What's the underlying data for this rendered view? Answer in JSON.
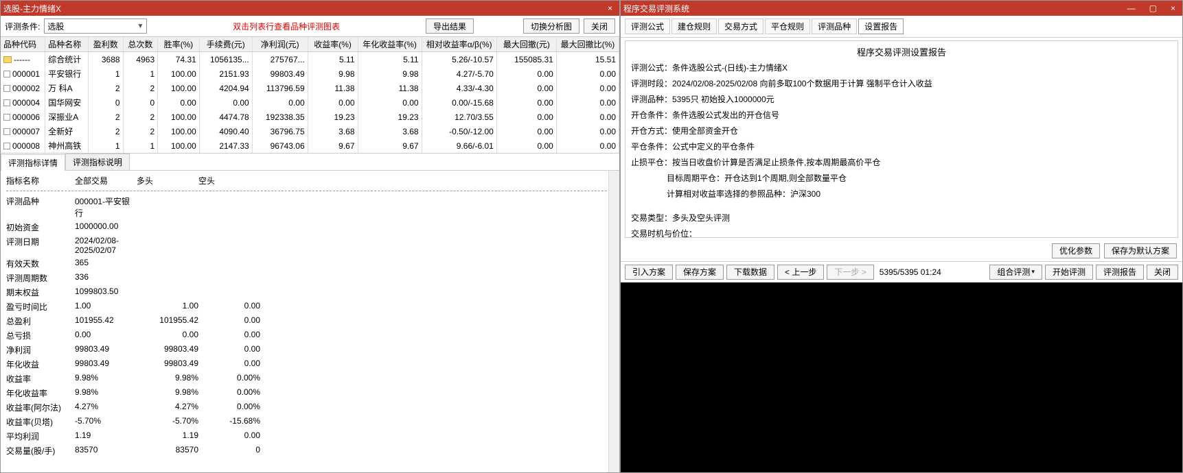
{
  "left": {
    "title": "选股-主力情绪X",
    "cond_label": "评测条件:",
    "cond_value": "选股",
    "hint": "双击列表行查看品种评测图表",
    "btn_export": "导出结果",
    "btn_switch": "切换分析图",
    "btn_close": "关闭",
    "columns": [
      "品种代码",
      "品种名称",
      "盈利数",
      "总次数",
      "胜率(%)",
      "手续费(元)",
      "净利润(元)",
      "收益率(%)",
      "年化收益率(%)",
      "相对收益率α/β(%)",
      "最大回撤(元)",
      "最大回撤比(%)"
    ],
    "rows": [
      {
        "icon": "folder",
        "code": "------",
        "name": "综合统计",
        "c": [
          "3688",
          "4963",
          "74.31",
          "1056135...",
          "275767...",
          "5.11",
          "5.11",
          "5.26/-10.57",
          "155085.31",
          "15.51"
        ]
      },
      {
        "icon": "doc",
        "code": "000001",
        "name": "平安银行",
        "c": [
          "1",
          "1",
          "100.00",
          "2151.93",
          "99803.49",
          "9.98",
          "9.98",
          "4.27/-5.70",
          "0.00",
          "0.00"
        ]
      },
      {
        "icon": "doc",
        "code": "000002",
        "name": "万  科A",
        "c": [
          "2",
          "2",
          "100.00",
          "4204.94",
          "113796.59",
          "11.38",
          "11.38",
          "4.33/-4.30",
          "0.00",
          "0.00"
        ]
      },
      {
        "icon": "doc",
        "code": "000004",
        "name": "国华网安",
        "c": [
          "0",
          "0",
          "0.00",
          "0.00",
          "0.00",
          "0.00",
          "0.00",
          "0.00/-15.68",
          "0.00",
          "0.00"
        ]
      },
      {
        "icon": "doc",
        "code": "000006",
        "name": "深振业A",
        "c": [
          "2",
          "2",
          "100.00",
          "4474.78",
          "192338.35",
          "19.23",
          "19.23",
          "12.70/3.55",
          "0.00",
          "0.00"
        ]
      },
      {
        "icon": "doc",
        "code": "000007",
        "name": "全新好",
        "c": [
          "2",
          "2",
          "100.00",
          "4090.40",
          "36796.75",
          "3.68",
          "3.68",
          "-0.50/-12.00",
          "0.00",
          "0.00"
        ]
      },
      {
        "icon": "doc",
        "code": "000008",
        "name": "神州高铁",
        "c": [
          "1",
          "1",
          "100.00",
          "2147.33",
          "96743.06",
          "9.67",
          "9.67",
          "9.66/-6.01",
          "0.00",
          "0.00"
        ]
      }
    ],
    "tab_detail": "评测指标详情",
    "tab_explain": "评测指标说明",
    "detail_header": [
      "指标名称",
      "全部交易",
      "多头",
      "空头"
    ],
    "details": [
      {
        "k": "评测品种",
        "v": [
          "000001-平安银行",
          "",
          ""
        ]
      },
      {
        "k": "初始资金",
        "v": [
          "1000000.00",
          "",
          ""
        ]
      },
      {
        "k": "评测日期",
        "v": [
          "2024/02/08-2025/02/07",
          "",
          ""
        ]
      },
      {
        "k": "有效天数",
        "v": [
          "365",
          "",
          ""
        ]
      },
      {
        "k": "评测周期数",
        "v": [
          "336",
          "",
          ""
        ]
      },
      {
        "k": "期末权益",
        "v": [
          "1099803.50",
          "",
          ""
        ]
      },
      {
        "k": "盈亏时间比",
        "v": [
          "1.00",
          "1.00",
          "0.00"
        ]
      },
      {
        "k": "总盈利",
        "v": [
          "101955.42",
          "101955.42",
          "0.00"
        ]
      },
      {
        "k": "总亏损",
        "v": [
          "0.00",
          "0.00",
          "0.00"
        ]
      },
      {
        "k": "净利润",
        "v": [
          "99803.49",
          "99803.49",
          "0.00"
        ]
      },
      {
        "k": "年化收益",
        "v": [
          "99803.49",
          "99803.49",
          "0.00"
        ]
      },
      {
        "k": "收益率",
        "v": [
          "9.98%",
          "9.98%",
          "0.00%"
        ]
      },
      {
        "k": "年化收益率",
        "v": [
          "9.98%",
          "9.98%",
          "0.00%"
        ]
      },
      {
        "k": "收益率(阿尔法)",
        "v": [
          "4.27%",
          "4.27%",
          "0.00%"
        ]
      },
      {
        "k": "收益率(贝塔)",
        "v": [
          "-5.70%",
          "-5.70%",
          "-15.68%"
        ]
      },
      {
        "k": "平均利润",
        "v": [
          "1.19",
          "1.19",
          "0.00"
        ]
      },
      {
        "k": "交易量(股/手)",
        "v": [
          "83570",
          "83570",
          "0"
        ]
      }
    ]
  },
  "right": {
    "title": "程序交易评测系统",
    "tabs": [
      "评测公式",
      "建仓规则",
      "交易方式",
      "平仓规则",
      "评测品种",
      "设置报告"
    ],
    "active_tab": 5,
    "report_title": "程序交易评测设置报告",
    "lines": [
      "评测公式：条件选股公式-(日线)-主力情绪X",
      "评测时段：2024/02/08-2025/02/08 向前多取100个数据用于计算 强制平仓计入收益",
      "评测品种：5395只 初始投入1000000元",
      "开仓条件：条件选股公式发出的开仓信号",
      "开仓方式：使用全部资金开仓",
      "平仓条件：公式中定义的平仓条件",
      "止损平仓：按当日收盘价计算是否满足止损条件,按本周期最高价平仓"
    ],
    "indented": [
      "目标周期平仓：开仓达到1个周期,则全部数量平仓",
      "计算相对收益率选择的参照品种：沪深300"
    ],
    "trade_type": "交易类型：多头及空头评测",
    "trade_time": "交易时机与价位：",
    "btn_opt": "优化参数",
    "btn_savedef": "保存为默认方案",
    "bottom": {
      "import": "引入方案",
      "save": "保存方案",
      "download": "下载数据",
      "prev": "< 上一步",
      "next": "下一步 >",
      "progress": "5395/5395  01:24",
      "combo_eval": "组合评测",
      "start": "开始评测",
      "report": "评测报告",
      "close": "关闭"
    }
  }
}
